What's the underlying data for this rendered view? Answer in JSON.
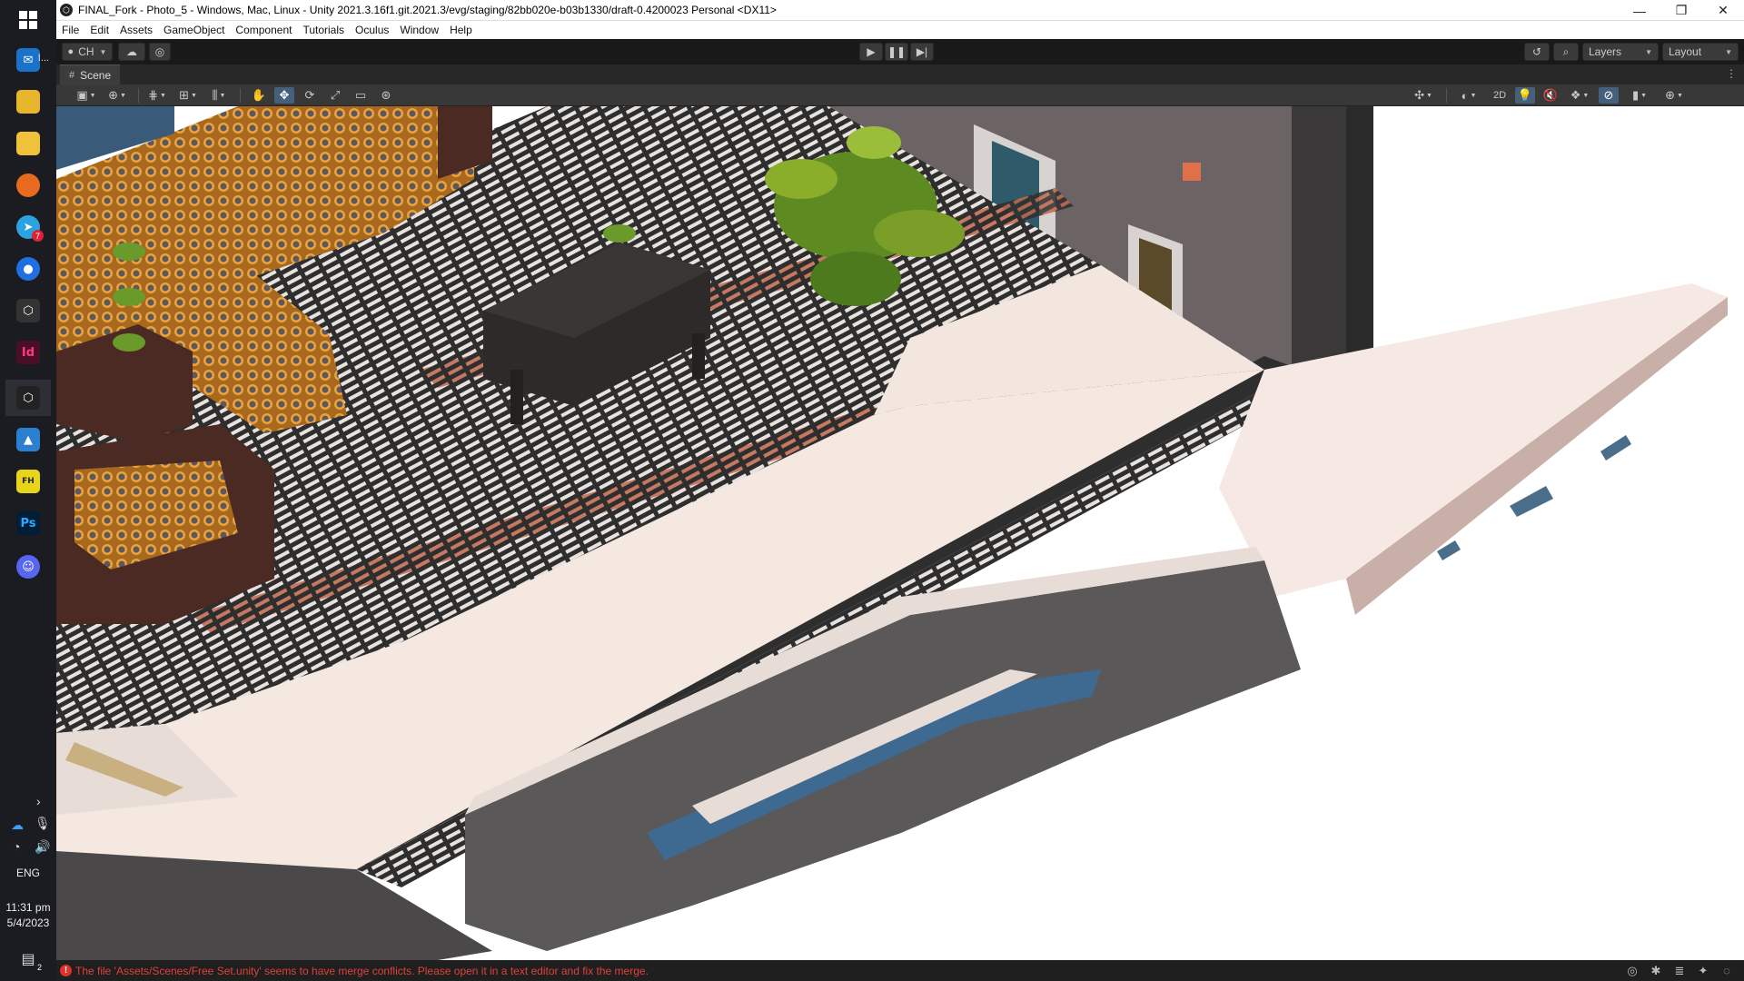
{
  "window": {
    "title": "FINAL_Fork - Photo_5 - Windows, Mac, Linux - Unity 2021.3.16f1.git.2021.3/evg/staging/82bb020e-b03b1330/draft-0.4200023 Personal <DX11>"
  },
  "menu": [
    "File",
    "Edit",
    "Assets",
    "GameObject",
    "Component",
    "Tutorials",
    "Oculus",
    "Window",
    "Help"
  ],
  "toolbar": {
    "account": "CH",
    "layers": "Layers",
    "layout": "Layout"
  },
  "scene": {
    "tab": "Scene",
    "mode_2d": "2D"
  },
  "taskbar": {
    "mail_label": "I...",
    "badge_count": "7",
    "language": "ENG",
    "time": "11:31 pm",
    "date": "5/4/2023",
    "notification_count": "2",
    "indesign_letters": "Id",
    "photoshop_letters": "Ps",
    "fh_letters": "FH"
  },
  "status": {
    "error_message": "The file 'Assets/Scenes/Free Set.unity' seems to have merge conflicts. Please open it in a text editor and fix the merge."
  },
  "colors": {
    "error": "#e0403a",
    "active_tool": "#46607c",
    "toolbar_bg": "#191919",
    "scene_toolbar_bg": "#383838"
  }
}
